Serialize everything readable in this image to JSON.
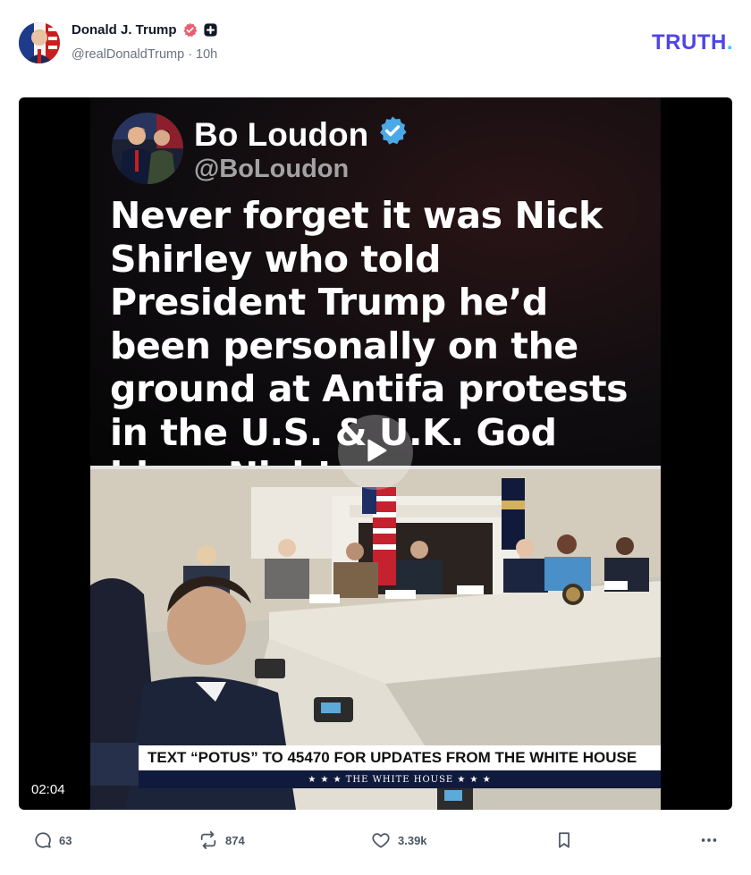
{
  "post": {
    "author": {
      "display_name": "Donald J. Trump",
      "handle": "@realDonaldTrump",
      "separator": "·",
      "time_ago": "10h"
    },
    "logo": {
      "text": "TRUTH",
      "dot": "."
    },
    "video": {
      "duration": "02:04",
      "embedded_tweet": {
        "name": "Bo Loudon",
        "handle": "@BoLoudon",
        "text": "Never forget it was Nick Shirley who told President Trump he’d been personally on the ground at Antifa protests in the U.S. & U.K. God bless Nick!"
      },
      "chyron": {
        "headline": "TEXT “POTUS” TO 45470 FOR UPDATES FROM THE WHITE HOUSE",
        "sub": "★ ★ ★   THE WHITE HOUSE   ★ ★ ★"
      }
    },
    "actions": {
      "replies": "63",
      "retruths": "874",
      "likes": "3.39k"
    }
  },
  "icons": {
    "verified": "verified-badge-icon",
    "plus": "plus-badge-icon",
    "play": "play-icon",
    "reply": "reply-icon",
    "retruth": "retruth-icon",
    "like": "heart-icon",
    "bookmark": "bookmark-icon",
    "more": "more-icon"
  },
  "colors": {
    "brand": "#4f46e5",
    "brand_accent": "#22d3ee",
    "verified_badge": "#e95f71",
    "tweet_verified": "#4ba8e6",
    "muted": "#6b7280"
  }
}
